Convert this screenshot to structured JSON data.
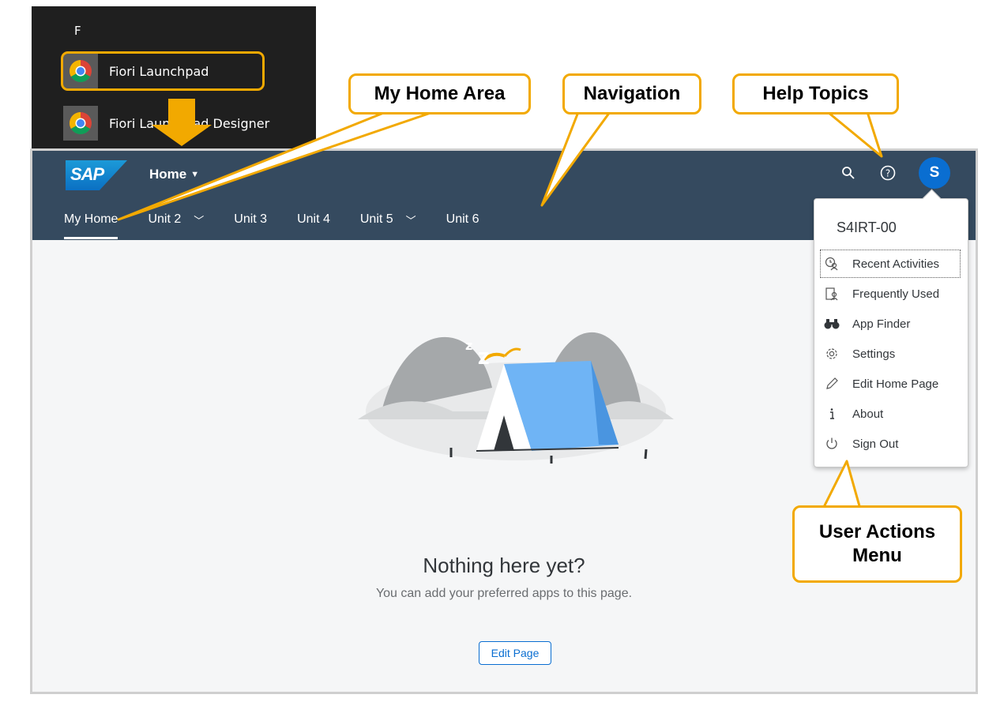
{
  "start_menu": {
    "letter": "F",
    "items": [
      {
        "label": "Fiori Launchpad",
        "icon": "chrome-icon"
      },
      {
        "label": "Fiori Launchpad Designer",
        "icon": "chrome-icon"
      }
    ]
  },
  "shell": {
    "logo": "SAP",
    "home_menu": "Home",
    "avatar_initial": "S",
    "nav": [
      {
        "label": "My Home",
        "active": true,
        "dropdown": false
      },
      {
        "label": "Unit 2",
        "active": false,
        "dropdown": true
      },
      {
        "label": "Unit 3",
        "active": false,
        "dropdown": false
      },
      {
        "label": "Unit 4",
        "active": false,
        "dropdown": false
      },
      {
        "label": "Unit 5",
        "active": false,
        "dropdown": true
      },
      {
        "label": "Unit 6",
        "active": false,
        "dropdown": false
      }
    ]
  },
  "empty_state": {
    "title": "Nothing here yet?",
    "subtitle": "You can add your preferred apps to this page.",
    "button": "Edit Page"
  },
  "user_menu": {
    "user": "S4IRT-00",
    "items": [
      {
        "label": "Recent Activities",
        "icon": "recent-activities-icon"
      },
      {
        "label": "Frequently Used",
        "icon": "frequently-used-icon"
      },
      {
        "label": "App Finder",
        "icon": "binoculars-icon"
      },
      {
        "label": "Settings",
        "icon": "gear-icon"
      },
      {
        "label": "Edit Home Page",
        "icon": "pencil-icon"
      },
      {
        "label": "About",
        "icon": "info-icon"
      },
      {
        "label": "Sign Out",
        "icon": "power-icon"
      }
    ]
  },
  "callouts": {
    "my_home_area": "My Home Area",
    "navigation": "Navigation",
    "help_topics": "Help Topics",
    "user_actions": "User Actions Menu"
  },
  "colors": {
    "shell": "#354a5f",
    "accent": "#0a6ed1",
    "callout_border": "#f2a900"
  }
}
